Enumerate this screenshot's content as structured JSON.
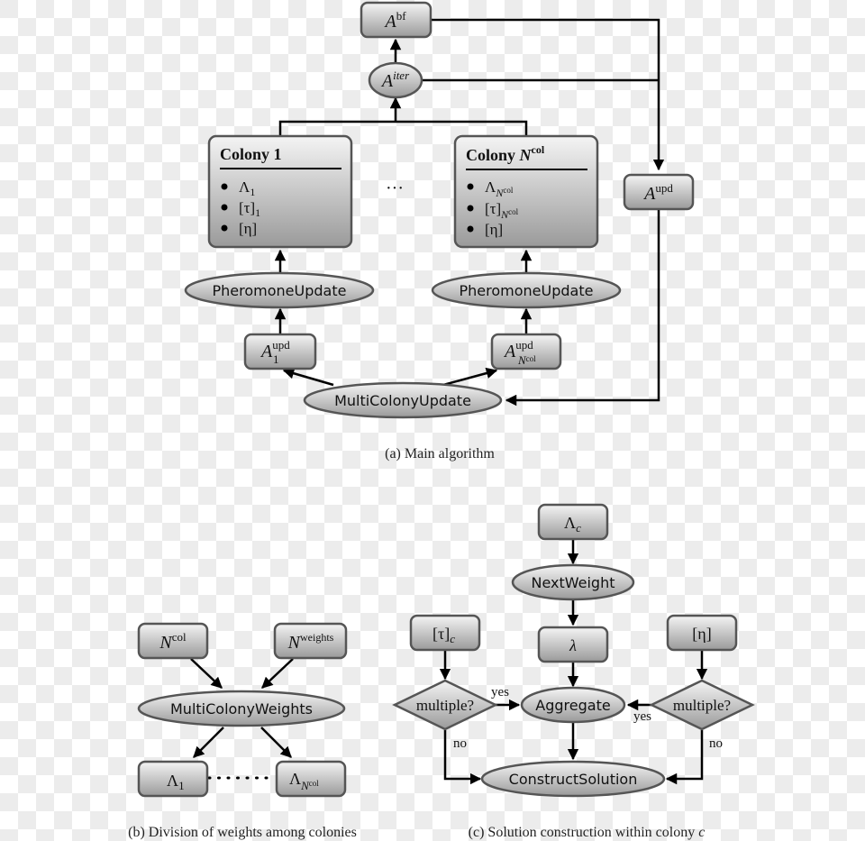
{
  "figure_a": {
    "caption": "(a) Main algorithm",
    "nodes": {
      "a_bf": {
        "base": "A",
        "sup": "bf"
      },
      "a_iter": {
        "base": "A",
        "sup": "iter"
      },
      "a_upd": {
        "base": "A",
        "sup": "upd"
      },
      "colony_1": {
        "title": "Colony 1",
        "items": [
          {
            "base": "Λ",
            "sub": "1"
          },
          {
            "base": "[τ]",
            "sub": "1"
          },
          {
            "base": "[η]",
            "sub": ""
          }
        ]
      },
      "ellipsis": "···",
      "colony_n": {
        "title_prefix": "Colony ",
        "title_var": "N",
        "title_sup": "col",
        "items": [
          {
            "base": "Λ",
            "sub": "N",
            "subsup": "col"
          },
          {
            "base": "[τ]",
            "sub": "N",
            "subsup": "col"
          },
          {
            "base": "[η]",
            "sub": ""
          }
        ]
      },
      "pheromone_update_1": "PheromoneUpdate",
      "pheromone_update_n": "PheromoneUpdate",
      "a1_upd": {
        "base": "A",
        "sup": "upd",
        "sub": "1"
      },
      "an_upd": {
        "base": "A",
        "sup": "upd",
        "sub": "N",
        "subsup": "col"
      },
      "multi_colony_update": "MultiColonyUpdate"
    }
  },
  "figure_b": {
    "caption": "(b) Division of weights among colonies",
    "nodes": {
      "n_col": {
        "base": "N",
        "sup": "col"
      },
      "n_weights": {
        "base": "N",
        "sup": "weights"
      },
      "multi_colony_weights": "MultiColonyWeights",
      "lambda_1": {
        "base": "Λ",
        "sub": "1"
      },
      "lambda_n": {
        "base": "Λ",
        "sub": "N",
        "subsup": "col"
      },
      "dots": "· · · · · · ·"
    }
  },
  "figure_c": {
    "caption_prefix": "(c) Solution construction within colony ",
    "caption_var": "c",
    "nodes": {
      "lambda_c": {
        "base": "Λ",
        "sub": "c"
      },
      "next_weight": "NextWeight",
      "lambda": "λ",
      "tau_c": {
        "base": "[τ]",
        "sub": "c"
      },
      "eta": "[η]",
      "multiple_left": "multiple?",
      "multiple_right": "multiple?",
      "aggregate": "Aggregate",
      "construct_solution": "ConstructSolution"
    },
    "edge_labels": {
      "yes_left": "yes",
      "yes_right": "yes",
      "no_left": "no",
      "no_right": "no"
    }
  }
}
